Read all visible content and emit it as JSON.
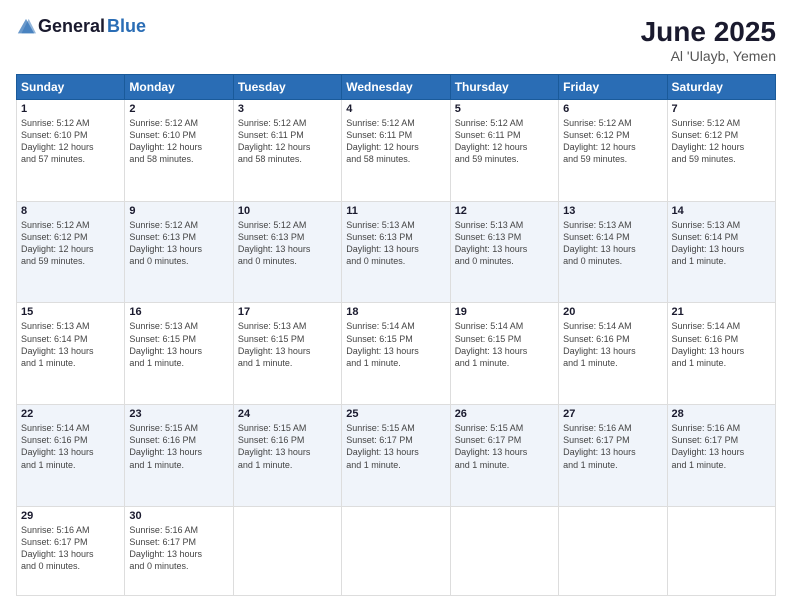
{
  "header": {
    "logo_general": "General",
    "logo_blue": "Blue",
    "month": "June 2025",
    "location": "Al 'Ulayb, Yemen"
  },
  "weekdays": [
    "Sunday",
    "Monday",
    "Tuesday",
    "Wednesday",
    "Thursday",
    "Friday",
    "Saturday"
  ],
  "weeks": [
    [
      {
        "day": "1",
        "info": "Sunrise: 5:12 AM\nSunset: 6:10 PM\nDaylight: 12 hours\nand 57 minutes."
      },
      {
        "day": "2",
        "info": "Sunrise: 5:12 AM\nSunset: 6:10 PM\nDaylight: 12 hours\nand 58 minutes."
      },
      {
        "day": "3",
        "info": "Sunrise: 5:12 AM\nSunset: 6:11 PM\nDaylight: 12 hours\nand 58 minutes."
      },
      {
        "day": "4",
        "info": "Sunrise: 5:12 AM\nSunset: 6:11 PM\nDaylight: 12 hours\nand 58 minutes."
      },
      {
        "day": "5",
        "info": "Sunrise: 5:12 AM\nSunset: 6:11 PM\nDaylight: 12 hours\nand 59 minutes."
      },
      {
        "day": "6",
        "info": "Sunrise: 5:12 AM\nSunset: 6:12 PM\nDaylight: 12 hours\nand 59 minutes."
      },
      {
        "day": "7",
        "info": "Sunrise: 5:12 AM\nSunset: 6:12 PM\nDaylight: 12 hours\nand 59 minutes."
      }
    ],
    [
      {
        "day": "8",
        "info": "Sunrise: 5:12 AM\nSunset: 6:12 PM\nDaylight: 12 hours\nand 59 minutes."
      },
      {
        "day": "9",
        "info": "Sunrise: 5:12 AM\nSunset: 6:13 PM\nDaylight: 13 hours\nand 0 minutes."
      },
      {
        "day": "10",
        "info": "Sunrise: 5:12 AM\nSunset: 6:13 PM\nDaylight: 13 hours\nand 0 minutes."
      },
      {
        "day": "11",
        "info": "Sunrise: 5:13 AM\nSunset: 6:13 PM\nDaylight: 13 hours\nand 0 minutes."
      },
      {
        "day": "12",
        "info": "Sunrise: 5:13 AM\nSunset: 6:13 PM\nDaylight: 13 hours\nand 0 minutes."
      },
      {
        "day": "13",
        "info": "Sunrise: 5:13 AM\nSunset: 6:14 PM\nDaylight: 13 hours\nand 0 minutes."
      },
      {
        "day": "14",
        "info": "Sunrise: 5:13 AM\nSunset: 6:14 PM\nDaylight: 13 hours\nand 1 minute."
      }
    ],
    [
      {
        "day": "15",
        "info": "Sunrise: 5:13 AM\nSunset: 6:14 PM\nDaylight: 13 hours\nand 1 minute."
      },
      {
        "day": "16",
        "info": "Sunrise: 5:13 AM\nSunset: 6:15 PM\nDaylight: 13 hours\nand 1 minute."
      },
      {
        "day": "17",
        "info": "Sunrise: 5:13 AM\nSunset: 6:15 PM\nDaylight: 13 hours\nand 1 minute."
      },
      {
        "day": "18",
        "info": "Sunrise: 5:14 AM\nSunset: 6:15 PM\nDaylight: 13 hours\nand 1 minute."
      },
      {
        "day": "19",
        "info": "Sunrise: 5:14 AM\nSunset: 6:15 PM\nDaylight: 13 hours\nand 1 minute."
      },
      {
        "day": "20",
        "info": "Sunrise: 5:14 AM\nSunset: 6:16 PM\nDaylight: 13 hours\nand 1 minute."
      },
      {
        "day": "21",
        "info": "Sunrise: 5:14 AM\nSunset: 6:16 PM\nDaylight: 13 hours\nand 1 minute."
      }
    ],
    [
      {
        "day": "22",
        "info": "Sunrise: 5:14 AM\nSunset: 6:16 PM\nDaylight: 13 hours\nand 1 minute."
      },
      {
        "day": "23",
        "info": "Sunrise: 5:15 AM\nSunset: 6:16 PM\nDaylight: 13 hours\nand 1 minute."
      },
      {
        "day": "24",
        "info": "Sunrise: 5:15 AM\nSunset: 6:16 PM\nDaylight: 13 hours\nand 1 minute."
      },
      {
        "day": "25",
        "info": "Sunrise: 5:15 AM\nSunset: 6:17 PM\nDaylight: 13 hours\nand 1 minute."
      },
      {
        "day": "26",
        "info": "Sunrise: 5:15 AM\nSunset: 6:17 PM\nDaylight: 13 hours\nand 1 minute."
      },
      {
        "day": "27",
        "info": "Sunrise: 5:16 AM\nSunset: 6:17 PM\nDaylight: 13 hours\nand 1 minute."
      },
      {
        "day": "28",
        "info": "Sunrise: 5:16 AM\nSunset: 6:17 PM\nDaylight: 13 hours\nand 1 minute."
      }
    ],
    [
      {
        "day": "29",
        "info": "Sunrise: 5:16 AM\nSunset: 6:17 PM\nDaylight: 13 hours\nand 0 minutes."
      },
      {
        "day": "30",
        "info": "Sunrise: 5:16 AM\nSunset: 6:17 PM\nDaylight: 13 hours\nand 0 minutes."
      },
      {
        "day": "",
        "info": ""
      },
      {
        "day": "",
        "info": ""
      },
      {
        "day": "",
        "info": ""
      },
      {
        "day": "",
        "info": ""
      },
      {
        "day": "",
        "info": ""
      }
    ]
  ]
}
